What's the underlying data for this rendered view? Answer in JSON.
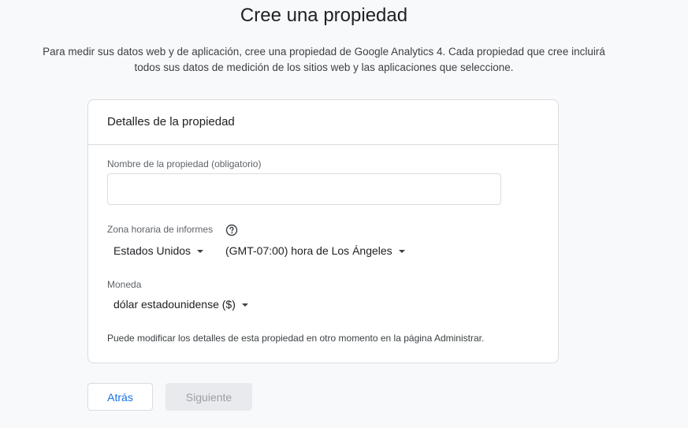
{
  "header": {
    "title": "Cree una propiedad",
    "intro_line1": "Para medir sus datos web y de aplicación, cree una propiedad de Google Analytics 4. Cada propiedad que cree incluirá",
    "intro_line2": "todos sus datos de medición de los sitios web y las aplicaciones que seleccione."
  },
  "card": {
    "title": "Detalles de la propiedad",
    "property_name": {
      "label": "Nombre de la propiedad (obligatorio)",
      "value": "",
      "placeholder": ""
    },
    "timezone": {
      "label": "Zona horaria de informes",
      "help_icon": "help-circle-icon",
      "country": "Estados Unidos",
      "zone": "(GMT-07:00) hora de Los Ángeles"
    },
    "currency": {
      "label": "Moneda",
      "value": "dólar estadounidense ($)"
    },
    "note": "Puede modificar los detalles de esta propiedad en otro momento en la página Administrar."
  },
  "actions": {
    "back_label": "Atrás",
    "next_label": "Siguiente"
  },
  "colors": {
    "accent": "#1a73e8",
    "disabled_bg": "#e8eaed",
    "disabled_text": "#9aa0a6"
  }
}
